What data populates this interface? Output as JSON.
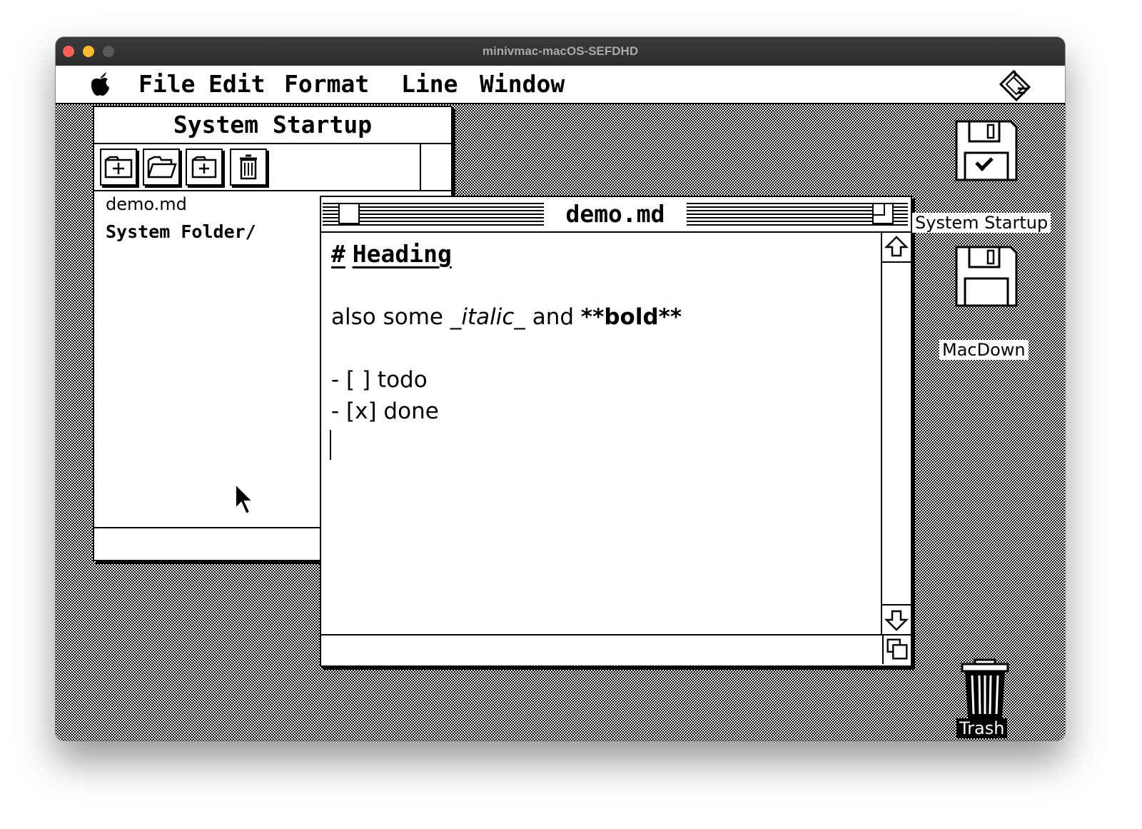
{
  "host": {
    "title": "minivmac-macOS-SEFDHD"
  },
  "menubar": {
    "apple_icon": "apple-icon",
    "items": [
      "File",
      "Edit",
      "Format",
      "Line",
      "Window"
    ],
    "right_icon": "application-icon"
  },
  "finder_window": {
    "title": "System Startup",
    "toolbar_icons": [
      "new-folder-icon",
      "open-folder-icon",
      "add-item-icon",
      "trash-can-icon"
    ],
    "files": [
      {
        "name": "demo.md",
        "style": "plain"
      },
      {
        "name": "System Folder/",
        "style": "bold"
      }
    ]
  },
  "document_window": {
    "title": "demo.md",
    "lines": {
      "heading_marker": "#",
      "heading": "Heading",
      "para_prefix": "also some ",
      "para_italic": "_italic_",
      "para_mid": " and ",
      "para_bold": "**bold**",
      "todo": "- [ ] todo",
      "done": "- [x] done"
    }
  },
  "desktop_icons": [
    {
      "name": "System Startup",
      "icon": "floppy-disk-icon"
    },
    {
      "name": "MacDown",
      "icon": "floppy-disk-icon"
    },
    {
      "name": "Trash",
      "icon": "trash-icon"
    }
  ],
  "colors": {
    "foreground": "#000000",
    "background": "#ffffff",
    "close": "#fe5f57",
    "minimize": "#febc2e"
  }
}
